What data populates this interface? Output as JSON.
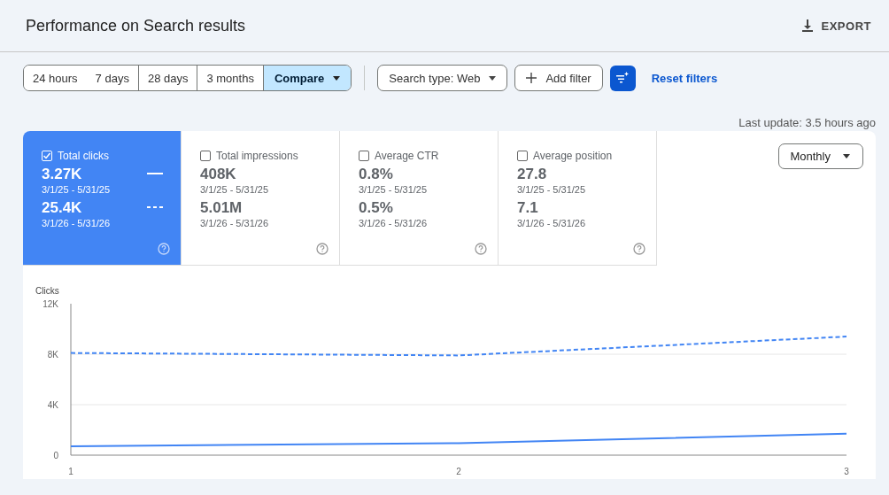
{
  "header": {
    "title": "Performance on Search results",
    "export_label": "EXPORT"
  },
  "toolbar": {
    "ranges": [
      {
        "label": "24 hours",
        "selected": false
      },
      {
        "label": "7 days",
        "selected": false
      },
      {
        "label": "28 days",
        "selected": false
      },
      {
        "label": "3 months",
        "selected": false
      },
      {
        "label": "Compare",
        "selected": true
      }
    ],
    "search_type": "Search type: Web",
    "add_filter": "Add filter",
    "reset": "Reset filters"
  },
  "last_update": "Last update: 3.5 hours ago",
  "metrics": [
    {
      "name": "Total clicks",
      "checked": true,
      "values": [
        {
          "value": "3.27K",
          "range": "3/1/25 - 5/31/25"
        },
        {
          "value": "25.4K",
          "range": "3/1/26 - 5/31/26"
        }
      ]
    },
    {
      "name": "Total impressions",
      "checked": false,
      "values": [
        {
          "value": "408K",
          "range": "3/1/25 - 5/31/25"
        },
        {
          "value": "5.01M",
          "range": "3/1/26 - 5/31/26"
        }
      ]
    },
    {
      "name": "Average CTR",
      "checked": false,
      "values": [
        {
          "value": "0.8%",
          "range": "3/1/25 - 5/31/25"
        },
        {
          "value": "0.5%",
          "range": "3/1/26 - 5/31/26"
        }
      ]
    },
    {
      "name": "Average position",
      "checked": false,
      "values": [
        {
          "value": "27.8",
          "range": "3/1/25 - 5/31/25"
        },
        {
          "value": "7.1",
          "range": "3/1/26 - 5/31/26"
        }
      ]
    }
  ],
  "granularity": "Monthly",
  "chart": {
    "chart_data": {
      "type": "line",
      "ylabel": "Clicks",
      "x": [
        1,
        2,
        3
      ],
      "xlim": [
        1,
        3
      ],
      "ylim": [
        0,
        12000
      ],
      "yticks": [
        {
          "value": 0,
          "label": "0"
        },
        {
          "value": 4000,
          "label": "4K"
        },
        {
          "value": 8000,
          "label": "8K"
        },
        {
          "value": 12000,
          "label": "12K"
        }
      ],
      "xticks": [
        1,
        2,
        3
      ],
      "series": [
        {
          "color": "#4285f4",
          "line_style": "solid",
          "values": [
            700,
            950,
            1700
          ]
        },
        {
          "color": "#4285f4",
          "line_style": "dashed",
          "values": [
            8100,
            7900,
            9400
          ]
        }
      ]
    }
  }
}
